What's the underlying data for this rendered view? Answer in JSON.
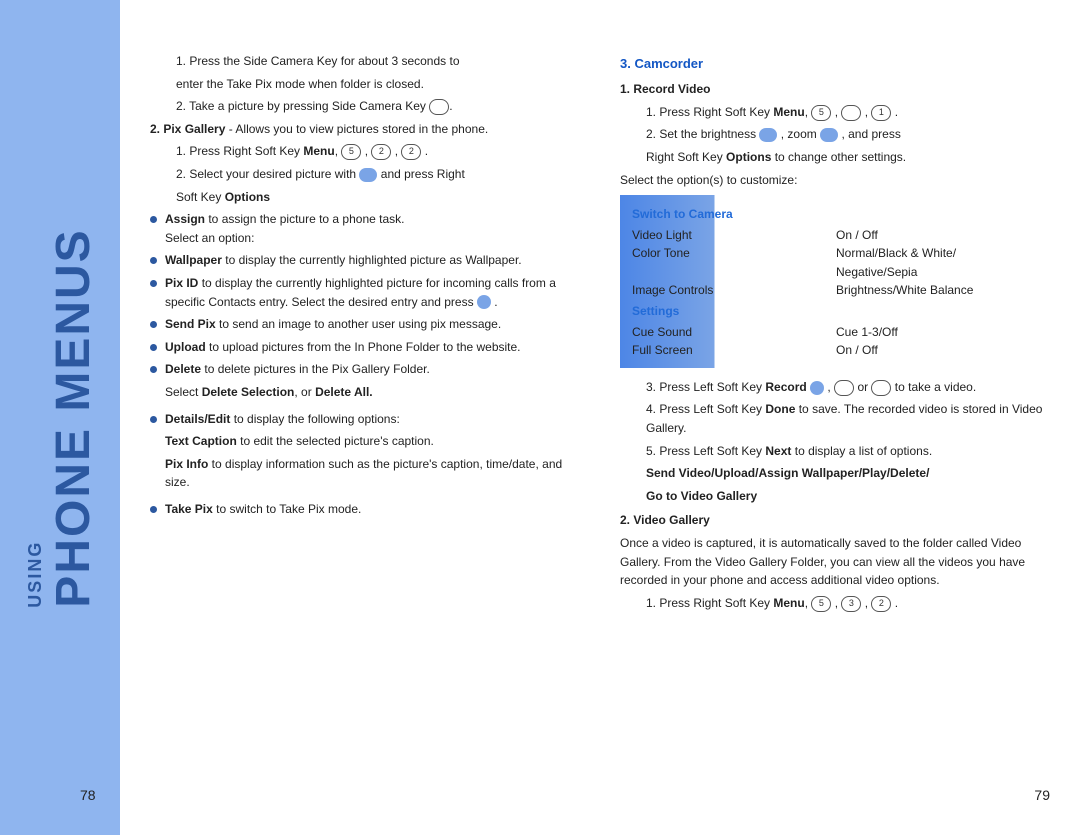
{
  "spine": {
    "big": "PHONE MENUS",
    "small": "USING"
  },
  "pageLeft": "78",
  "pageRight": "79",
  "left": {
    "l1": "1. Press the Side Camera Key for about 3 seconds to",
    "l2": "enter the Take Pix mode when folder is closed.",
    "l3": "2. Take a picture by pressing Side Camera Key",
    "pixGalleryLabel": "2. Pix Gallery",
    "pixGalleryRest": " - Allows you to view pictures stored in the phone.",
    "step1a": "1. Press Right Soft Key ",
    "menuWord": "Menu",
    "comma": ", ",
    "k5": "5",
    "k2": "2",
    "step2a": "2. Select your desired picture with ",
    "step2b": " and press Right",
    "softKeyOptions": "Soft Key ",
    "optionsWord": "Options",
    ".": ".",
    "assign": "Assign",
    "assignRest": " to assign the picture to a phone task.",
    "selectOption": "Select an option:",
    "wallpaper": "Wallpaper",
    "wallpaperRest": " to display the currently highlighted picture as Wallpaper.",
    "pixId": "Pix ID",
    "pixIdRest": " to display the currently highlighted picture for incoming calls from a specific Contacts entry. Select the desired entry and press ",
    "sendPix": "Send Pix",
    "sendPixRest": " to send an image to another user using pix message.",
    "upload": "Upload",
    "uploadRest": " to upload pictures from the In Phone Folder to the website.",
    "delete": "Delete",
    "deleteRest": " to delete pictures in the Pix Gallery Folder.",
    "selectDel": "Select ",
    "delSel": "Delete Selection",
    "or": ", or ",
    "delAll": "Delete All.",
    "detailsEdit": "Details/Edit",
    "detailsRest": " to display the following options:",
    "textCaption": "Text Caption",
    "textCaptionRest": " to edit the selected picture's caption.",
    "pixInfo": "Pix Info",
    "pixInfoRest": " to display information such as the picture's caption, time/date, and size.",
    "takePix": "Take Pix",
    "takePixRest": " to switch to Take Pix mode."
  },
  "right": {
    "hCamcorder": "3. Camcorder",
    "hRecord": "1. Record Video",
    "r1a": "1. Press Right Soft Key ",
    "k5": "5",
    "k1": "1",
    "r2a": "2. Set the brightness ",
    "r2b": ", zoom ",
    "r2c": ", and press",
    "r2d": "Right Soft Key ",
    "optionsWord": "Options",
    "r2e": " to change other settings.",
    "selOpt": "Select the option(s) to customize:",
    "opt": {
      "switch": "Switch to Camera",
      "videoLight": "Video Light",
      "videoLightV": "On / Off",
      "colorTone": "Color Tone",
      "colorToneV": "Normal/Black & White/",
      "colorToneV2": "Negative/Sepia",
      "imageControls": "Image Controls",
      "imageControlsV": "Brightness/White Balance",
      "settings": "Settings",
      "cueSound": "Cue Sound",
      "cueSoundV": "Cue 1-3/Off",
      "fullScreen": "Full Screen",
      "fullScreenV": "On / Off"
    },
    "r3a": "3. Press Left Soft Key ",
    "record": "Record",
    "r3b": " , ",
    "r3c": " or ",
    "r3d": " to take a video.",
    "r4a": "4. Press Left Soft Key ",
    "done": "Done",
    "r4b": " to save. The recorded video is stored in Video Gallery.",
    "r5a": "5. Press Left Soft Key ",
    "next": "Next",
    "r5b": " to display a list of options.",
    "sendEtc": "Send Video/Upload/Assign Wallpaper/Play/Delete/",
    "goto": "Go to Video Gallery",
    "hVideoGallery": "2. Video Gallery",
    "vgPara": "Once a video is captured, it is automatically saved to the folder called Video Gallery. From the Video Gallery Folder, you can view all the videos you have recorded in your phone and access additional video options.",
    "vg1": "1. Press Right Soft Key ",
    "k3": "3",
    "k2": "2"
  }
}
